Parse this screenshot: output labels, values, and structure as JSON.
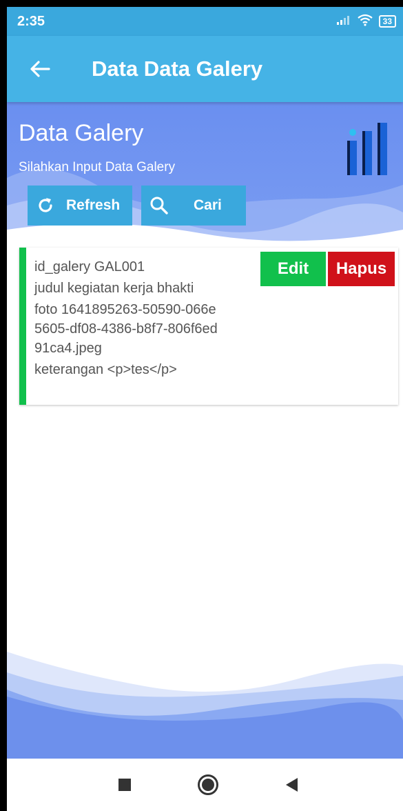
{
  "status_bar": {
    "time": "2:35",
    "battery": "33"
  },
  "app_bar": {
    "title": "Data Data Galery"
  },
  "header": {
    "title": "Data Galery",
    "subtitle": "Silahkan Input Data Galery",
    "refresh_label": "Refresh",
    "search_label": "Cari"
  },
  "card": {
    "line1": "id_galery GAL001",
    "line2": "judul kegiatan kerja bhakti",
    "line3a": "foto 1641895263-50590-066e",
    "line3b": "5605-df08-4386-b8f7-806f6ed",
    "line3c": "91ca4.jpeg",
    "line4": "keterangan <p>tes</p>",
    "edit_label": "Edit",
    "delete_label": "Hapus"
  },
  "colors": {
    "primary": "#45b3e6",
    "header_bg": "#6a8ff0",
    "edit": "#11c04c",
    "delete": "#d0111a"
  }
}
